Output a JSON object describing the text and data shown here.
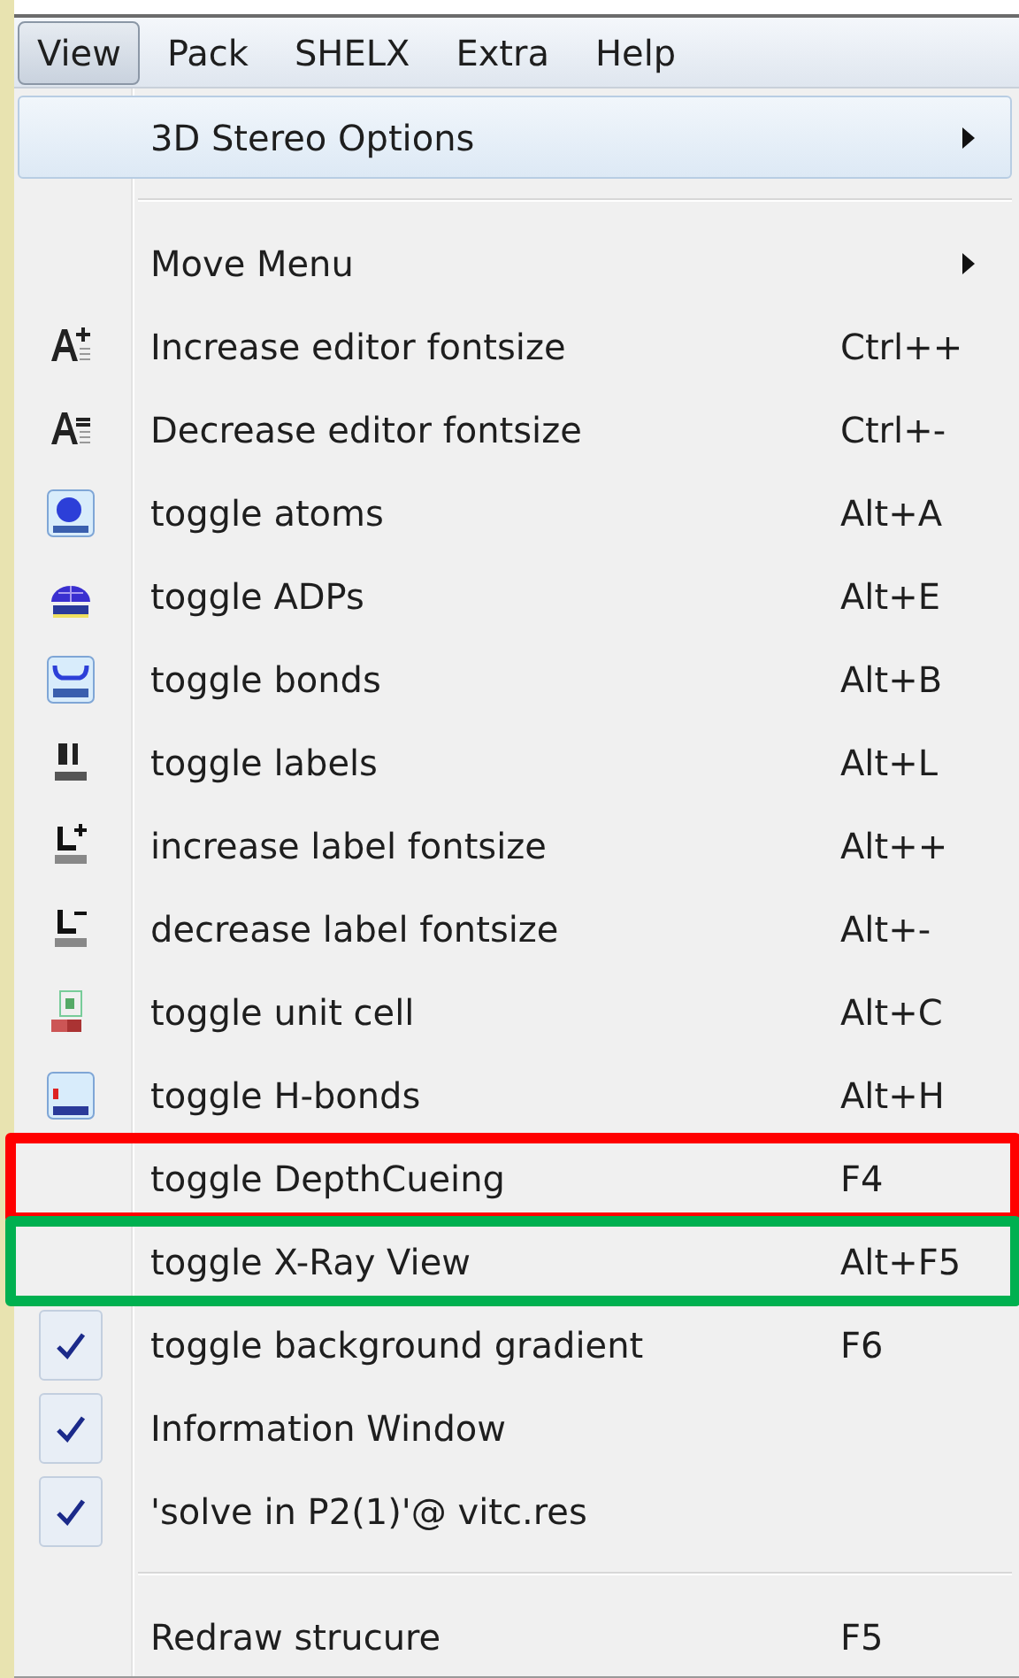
{
  "menubar": [
    {
      "label": "View",
      "selected": true
    },
    {
      "label": "Pack",
      "selected": false
    },
    {
      "label": "SHELX",
      "selected": false
    },
    {
      "label": "Extra",
      "selected": false
    },
    {
      "label": "Help",
      "selected": false
    }
  ],
  "menu": {
    "items": [
      {
        "kind": "submenu",
        "label": "3D Stereo Options",
        "selected": true
      },
      {
        "kind": "separator"
      },
      {
        "kind": "submenu",
        "label": "Move Menu",
        "selected": false
      },
      {
        "kind": "command",
        "label": "Increase editor fontsize",
        "shortcut": "Ctrl++"
      },
      {
        "kind": "command",
        "label": "Decrease editor fontsize",
        "shortcut": "Ctrl+-"
      },
      {
        "kind": "command",
        "label": "toggle atoms",
        "shortcut": "Alt+A"
      },
      {
        "kind": "command",
        "label": "toggle ADPs",
        "shortcut": "Alt+E"
      },
      {
        "kind": "command",
        "label": "toggle bonds",
        "shortcut": "Alt+B"
      },
      {
        "kind": "command",
        "label": "toggle labels",
        "shortcut": "Alt+L"
      },
      {
        "kind": "command",
        "label": "increase label fontsize",
        "shortcut": "Alt++"
      },
      {
        "kind": "command",
        "label": "decrease label fontsize",
        "shortcut": "Alt+-"
      },
      {
        "kind": "command",
        "label": "toggle unit cell",
        "shortcut": "Alt+C"
      },
      {
        "kind": "command",
        "label": "toggle H-bonds",
        "shortcut": "Alt+H"
      },
      {
        "kind": "checkable",
        "label": "toggle DepthCueing",
        "shortcut": "F4",
        "checked": false,
        "color": "#ff0000"
      },
      {
        "kind": "checkable",
        "label": "toggle X-Ray View",
        "shortcut": "Alt+F5",
        "checked": false,
        "color": "#00b050"
      },
      {
        "kind": "checkable",
        "label": "toggle background gradient",
        "shortcut": "F6",
        "checked": true
      },
      {
        "kind": "checkable",
        "label": "Information Window",
        "checked": true
      },
      {
        "kind": "checkable",
        "label": "'solve in P2(1)'@ vitc.res",
        "checked": true
      },
      {
        "kind": "separator"
      },
      {
        "kind": "command",
        "label": "Redraw strucure",
        "shortcut": "F5"
      }
    ]
  }
}
